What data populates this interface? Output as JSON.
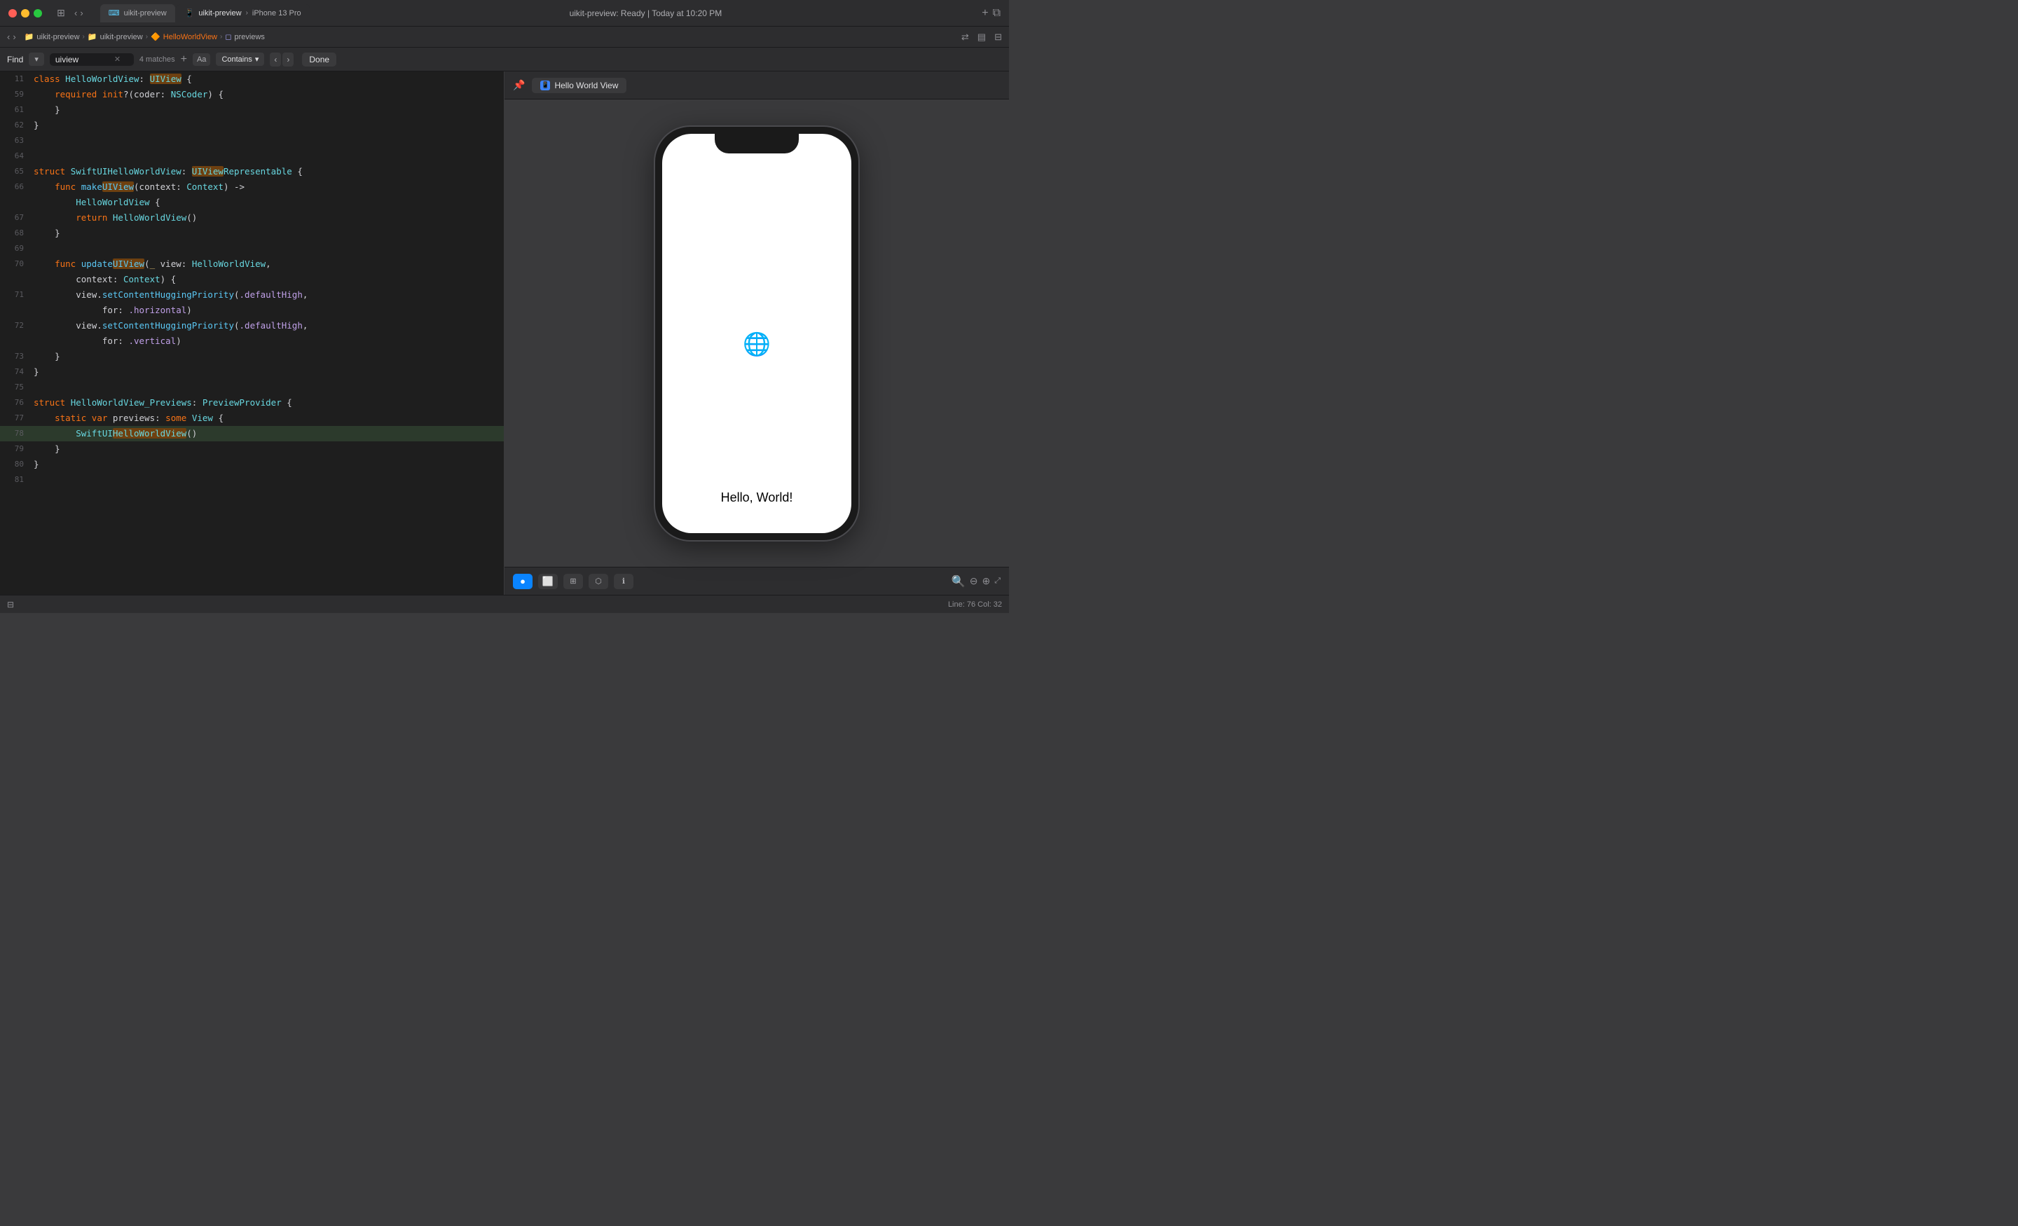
{
  "window": {
    "title": "uikit-preview: Ready | Today at 10:20 PM"
  },
  "tabs": [
    {
      "label": "uikit-preview",
      "icon": "xcode-icon",
      "active": false
    },
    {
      "label": "uikit-preview",
      "icon": "phone-icon",
      "subtitle": "iPhone 13 Pro",
      "active": true
    }
  ],
  "breadcrumb": {
    "items": [
      {
        "label": "uikit-preview",
        "icon": "📁",
        "color": "default"
      },
      {
        "label": "uikit-preview",
        "icon": "📁",
        "color": "default"
      },
      {
        "label": "HelloWorldView",
        "icon": "🔶",
        "color": "swift"
      },
      {
        "label": "previews",
        "icon": "◻",
        "color": "default"
      }
    ]
  },
  "findbar": {
    "label": "Find",
    "type": "uiview",
    "matches": "4 matches",
    "aa_label": "Aa",
    "contains_label": "Contains",
    "done_label": "Done"
  },
  "code": {
    "lines": [
      {
        "num": "11",
        "content": "class HelloWorldView: UIView {",
        "highlighted": false
      },
      {
        "num": "59",
        "content": "    required init?(coder: NSCoder) {",
        "highlighted": false
      },
      {
        "num": "61",
        "content": "    }",
        "highlighted": false
      },
      {
        "num": "62",
        "content": "}",
        "highlighted": false
      },
      {
        "num": "63",
        "content": "",
        "highlighted": false
      },
      {
        "num": "64",
        "content": "",
        "highlighted": false
      },
      {
        "num": "65",
        "content": "struct SwiftUIHelloWorldView: UIViewRepresentable {",
        "highlighted": false
      },
      {
        "num": "66",
        "content": "    func makeUIView(context: Context) ->",
        "highlighted": false
      },
      {
        "num": "",
        "content": "        HelloWorldView {",
        "highlighted": false
      },
      {
        "num": "67",
        "content": "        return HelloWorldView()",
        "highlighted": false
      },
      {
        "num": "68",
        "content": "    }",
        "highlighted": false
      },
      {
        "num": "69",
        "content": "",
        "highlighted": false
      },
      {
        "num": "70",
        "content": "    func updateUIView(_ view: HelloWorldView,",
        "highlighted": false
      },
      {
        "num": "",
        "content": "        context: Context) {",
        "highlighted": false
      },
      {
        "num": "71",
        "content": "        view.setContentHuggingPriority(.defaultHigh,",
        "highlighted": false
      },
      {
        "num": "",
        "content": "             for: .horizontal)",
        "highlighted": false
      },
      {
        "num": "72",
        "content": "        view.setContentHuggingPriority(.defaultHigh,",
        "highlighted": false
      },
      {
        "num": "",
        "content": "             for: .vertical)",
        "highlighted": false
      },
      {
        "num": "73",
        "content": "    }",
        "highlighted": false
      },
      {
        "num": "74",
        "content": "}",
        "highlighted": false
      },
      {
        "num": "75",
        "content": "",
        "highlighted": false
      },
      {
        "num": "76",
        "content": "struct HelloWorldView_Previews: PreviewProvider {",
        "highlighted": false
      },
      {
        "num": "77",
        "content": "    static var previews: some View {",
        "highlighted": false
      },
      {
        "num": "78",
        "content": "        SwiftUIHelloWorldView()",
        "highlighted": true
      },
      {
        "num": "79",
        "content": "    }",
        "highlighted": false
      },
      {
        "num": "80",
        "content": "}",
        "highlighted": false
      },
      {
        "num": "81",
        "content": "",
        "highlighted": false
      }
    ]
  },
  "preview": {
    "header": {
      "title": "Hello World View",
      "icon": "📱"
    },
    "phone": {
      "hello_text": "Hello, World!",
      "globe_emoji": "🌐"
    },
    "bottom_buttons": [
      {
        "label": "●",
        "active": true,
        "title": "live"
      },
      {
        "label": "⬜",
        "active": false,
        "title": "static"
      },
      {
        "label": "⊞",
        "active": false,
        "title": "variants"
      },
      {
        "label": "⬡",
        "active": false,
        "title": "device"
      },
      {
        "label": "ℹ",
        "active": false,
        "title": "info"
      }
    ],
    "zoom_buttons": [
      "zoom-out",
      "zoom-reset",
      "zoom-in",
      "zoom-fit"
    ]
  },
  "statusbar": {
    "line_col": "Line: 76  Col: 32"
  }
}
